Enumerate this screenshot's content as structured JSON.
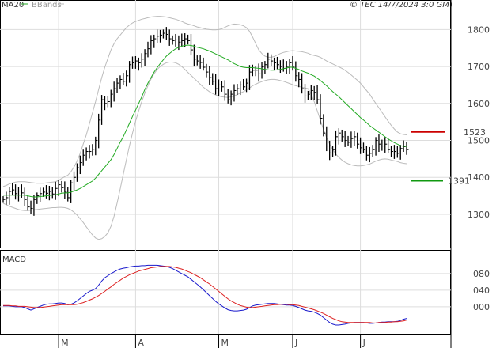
{
  "header": {
    "legend_ma": "MA20",
    "legend_bb": "BBands",
    "timestamp": "© TEC 14/7/2024 3:0 GMT"
  },
  "colors": {
    "ma": "#22aa22",
    "bbands": "#bbbbbb",
    "price": "#000000",
    "macd": "#1a1acc",
    "signal": "#dd2222",
    "resistance": "#cc0000",
    "support": "#119911",
    "grid": "#dddddd"
  },
  "chart_data": [
    {
      "type": "ohlc",
      "ylim": [
        1210,
        1880
      ],
      "yticks": [
        "1800",
        "1700",
        "1600",
        "1500",
        "1400",
        "1300"
      ],
      "x_months": [
        "M",
        "A",
        "M",
        "J",
        "J"
      ],
      "levels": [
        {
          "label": "1523",
          "value": 1523,
          "color": "resistance"
        },
        {
          "label": "1391",
          "value": 1391,
          "color": "support"
        }
      ],
      "price": [
        1340,
        1345,
        1362,
        1366,
        1356,
        1363,
        1358,
        1340,
        1320,
        1316,
        1340,
        1350,
        1356,
        1360,
        1357,
        1362,
        1355,
        1370,
        1380,
        1372,
        1360,
        1345,
        1385,
        1400,
        1426,
        1440,
        1460,
        1470,
        1470,
        1476,
        1500,
        1555,
        1610,
        1600,
        1605,
        1625,
        1640,
        1655,
        1665,
        1660,
        1675,
        1705,
        1710,
        1715,
        1710,
        1720,
        1735,
        1748,
        1770,
        1775,
        1782,
        1785,
        1790,
        1787,
        1775,
        1770,
        1772,
        1766,
        1770,
        1775,
        1770,
        1745,
        1720,
        1715,
        1711,
        1698,
        1685,
        1670,
        1660,
        1640,
        1650,
        1645,
        1625,
        1610,
        1625,
        1635,
        1640,
        1650,
        1645,
        1655,
        1685,
        1690,
        1690,
        1680,
        1699,
        1705,
        1720,
        1715,
        1710,
        1705,
        1700,
        1695,
        1700,
        1710,
        1700,
        1675,
        1665,
        1640,
        1620,
        1625,
        1635,
        1630,
        1610,
        1560,
        1520,
        1485,
        1466,
        1475,
        1510,
        1520,
        1510,
        1500,
        1495,
        1505,
        1510,
        1490,
        1480,
        1475,
        1460,
        1465,
        1475,
        1500,
        1490,
        1485,
        1490,
        1475,
        1470,
        1470,
        1465,
        1478,
        1483,
        1475
      ],
      "ma": [
        1352,
        1352,
        1352,
        1352,
        1352,
        1352,
        1352,
        1352,
        1350,
        1348,
        1347,
        1347,
        1348,
        1349,
        1350,
        1351,
        1352,
        1353,
        1355,
        1357,
        1358,
        1358,
        1360,
        1363,
        1366,
        1370,
        1375,
        1380,
        1385,
        1390,
        1398,
        1408,
        1418,
        1428,
        1438,
        1448,
        1462,
        1478,
        1495,
        1510,
        1528,
        1546,
        1565,
        1582,
        1600,
        1618,
        1638,
        1655,
        1670,
        1685,
        1697,
        1708,
        1718,
        1728,
        1735,
        1742,
        1748,
        1752,
        1755,
        1757,
        1758,
        1757,
        1755,
        1752,
        1750,
        1748,
        1745,
        1742,
        1738,
        1734,
        1730,
        1726,
        1722,
        1718,
        1713,
        1708,
        1704,
        1700,
        1698,
        1697,
        1697,
        1697,
        1696,
        1695,
        1694,
        1692,
        1691,
        1690,
        1690,
        1691,
        1692,
        1694,
        1696,
        1698,
        1698,
        1695,
        1692,
        1688,
        1685,
        1682,
        1678,
        1674,
        1668,
        1662,
        1655,
        1648,
        1640,
        1632,
        1625,
        1618,
        1610,
        1602,
        1594,
        1586,
        1578,
        1570,
        1562,
        1555,
        1548,
        1540,
        1534,
        1528,
        1522,
        1516,
        1510,
        1504,
        1499,
        1494,
        1490,
        1486,
        1484,
        1484
      ],
      "bb_upper": [
        1375,
        1378,
        1382,
        1385,
        1387,
        1388,
        1388,
        1388,
        1387,
        1386,
        1385,
        1384,
        1384,
        1384,
        1385,
        1386,
        1387,
        1388,
        1392,
        1397,
        1402,
        1406,
        1415,
        1428,
        1444,
        1465,
        1490,
        1515,
        1545,
        1575,
        1605,
        1638,
        1670,
        1698,
        1722,
        1745,
        1762,
        1775,
        1785,
        1795,
        1805,
        1812,
        1818,
        1822,
        1825,
        1828,
        1830,
        1832,
        1834,
        1835,
        1836,
        1836,
        1835,
        1834,
        1832,
        1830,
        1828,
        1825,
        1822,
        1818,
        1815,
        1813,
        1810,
        1807,
        1805,
        1803,
        1801,
        1800,
        1799,
        1799,
        1800,
        1802,
        1806,
        1810,
        1813,
        1815,
        1814,
        1813,
        1810,
        1805,
        1795,
        1780,
        1762,
        1745,
        1735,
        1728,
        1725,
        1725,
        1727,
        1731,
        1735,
        1738,
        1740,
        1742,
        1743,
        1742,
        1741,
        1740,
        1738,
        1736,
        1732,
        1730,
        1728,
        1725,
        1720,
        1715,
        1711,
        1707,
        1703,
        1699,
        1695,
        1690,
        1684,
        1677,
        1670,
        1663,
        1655,
        1645,
        1635,
        1625,
        1612,
        1600,
        1588,
        1576,
        1564,
        1552,
        1541,
        1531,
        1523,
        1518,
        1516,
        1515
      ],
      "bb_lower": [
        1330,
        1326,
        1322,
        1319,
        1316,
        1313,
        1311,
        1310,
        1310,
        1311,
        1312,
        1313,
        1314,
        1315,
        1316,
        1317,
        1318,
        1318,
        1319,
        1319,
        1318,
        1316,
        1312,
        1306,
        1298,
        1288,
        1278,
        1266,
        1255,
        1244,
        1236,
        1232,
        1234,
        1240,
        1250,
        1268,
        1295,
        1330,
        1368,
        1408,
        1447,
        1485,
        1520,
        1552,
        1580,
        1605,
        1628,
        1648,
        1666,
        1680,
        1692,
        1700,
        1706,
        1710,
        1712,
        1712,
        1710,
        1706,
        1700,
        1692,
        1684,
        1676,
        1668,
        1660,
        1652,
        1644,
        1638,
        1632,
        1627,
        1623,
        1620,
        1618,
        1617,
        1616,
        1618,
        1620,
        1624,
        1628,
        1632,
        1637,
        1642,
        1648,
        1652,
        1656,
        1659,
        1662,
        1664,
        1665,
        1665,
        1664,
        1662,
        1660,
        1657,
        1654,
        1651,
        1648,
        1646,
        1644,
        1642,
        1640,
        1625,
        1605,
        1580,
        1555,
        1530,
        1508,
        1490,
        1475,
        1463,
        1454,
        1447,
        1441,
        1437,
        1434,
        1432,
        1431,
        1431,
        1432,
        1434,
        1436,
        1440,
        1444,
        1447,
        1449,
        1450,
        1449,
        1447,
        1445,
        1443,
        1440,
        1438,
        1437
      ]
    },
    {
      "type": "line",
      "title": "MACD",
      "ylim": [
        -0.65,
        1.35
      ],
      "yticks": [
        "080",
        "040",
        "000"
      ],
      "macd": [
        0.02,
        0.02,
        0.02,
        0.01,
        0.0,
        0.0,
        0.0,
        -0.02,
        -0.05,
        -0.08,
        -0.05,
        -0.02,
        0.01,
        0.04,
        0.06,
        0.07,
        0.07,
        0.08,
        0.09,
        0.09,
        0.08,
        0.05,
        0.06,
        0.09,
        0.14,
        0.2,
        0.26,
        0.32,
        0.37,
        0.4,
        0.44,
        0.52,
        0.62,
        0.7,
        0.75,
        0.8,
        0.84,
        0.88,
        0.91,
        0.93,
        0.94,
        0.96,
        0.97,
        0.98,
        0.98,
        0.99,
        0.99,
        1.0,
        1.0,
        1.0,
        1.0,
        0.99,
        0.98,
        0.97,
        0.95,
        0.92,
        0.88,
        0.84,
        0.8,
        0.76,
        0.72,
        0.66,
        0.6,
        0.54,
        0.48,
        0.41,
        0.34,
        0.27,
        0.2,
        0.13,
        0.07,
        0.02,
        -0.03,
        -0.07,
        -0.09,
        -0.1,
        -0.1,
        -0.09,
        -0.08,
        -0.06,
        -0.02,
        0.02,
        0.04,
        0.05,
        0.06,
        0.07,
        0.08,
        0.08,
        0.08,
        0.07,
        0.06,
        0.05,
        0.04,
        0.04,
        0.03,
        0.01,
        -0.02,
        -0.05,
        -0.08,
        -0.1,
        -0.11,
        -0.13,
        -0.16,
        -0.2,
        -0.26,
        -0.32,
        -0.38,
        -0.42,
        -0.44,
        -0.44,
        -0.43,
        -0.42,
        -0.4,
        -0.39,
        -0.38,
        -0.38,
        -0.38,
        -0.38,
        -0.39,
        -0.4,
        -0.4,
        -0.39,
        -0.38,
        -0.37,
        -0.37,
        -0.36,
        -0.36,
        -0.36,
        -0.35,
        -0.33,
        -0.3,
        -0.28
      ],
      "signal": [
        0.03,
        0.03,
        0.03,
        0.02,
        0.02,
        0.01,
        0.01,
        0.01,
        0.0,
        -0.01,
        -0.02,
        -0.02,
        -0.02,
        -0.01,
        0.0,
        0.01,
        0.02,
        0.03,
        0.04,
        0.05,
        0.05,
        0.05,
        0.05,
        0.05,
        0.06,
        0.08,
        0.1,
        0.13,
        0.16,
        0.19,
        0.23,
        0.27,
        0.32,
        0.37,
        0.43,
        0.48,
        0.54,
        0.59,
        0.64,
        0.69,
        0.73,
        0.77,
        0.8,
        0.83,
        0.86,
        0.88,
        0.9,
        0.92,
        0.94,
        0.95,
        0.96,
        0.97,
        0.97,
        0.97,
        0.97,
        0.96,
        0.95,
        0.93,
        0.91,
        0.88,
        0.85,
        0.82,
        0.78,
        0.74,
        0.7,
        0.65,
        0.6,
        0.55,
        0.49,
        0.43,
        0.37,
        0.31,
        0.25,
        0.19,
        0.14,
        0.1,
        0.06,
        0.03,
        0.01,
        -0.01,
        -0.02,
        -0.02,
        -0.01,
        0.0,
        0.01,
        0.02,
        0.03,
        0.04,
        0.05,
        0.05,
        0.06,
        0.06,
        0.06,
        0.05,
        0.05,
        0.04,
        0.03,
        0.01,
        -0.01,
        -0.03,
        -0.05,
        -0.07,
        -0.1,
        -0.13,
        -0.16,
        -0.2,
        -0.24,
        -0.28,
        -0.31,
        -0.34,
        -0.36,
        -0.37,
        -0.38,
        -0.38,
        -0.38,
        -0.38,
        -0.38,
        -0.38,
        -0.38,
        -0.38,
        -0.39,
        -0.39,
        -0.38,
        -0.38,
        -0.38,
        -0.37,
        -0.37,
        -0.36,
        -0.36,
        -0.35,
        -0.34,
        -0.32
      ]
    }
  ]
}
